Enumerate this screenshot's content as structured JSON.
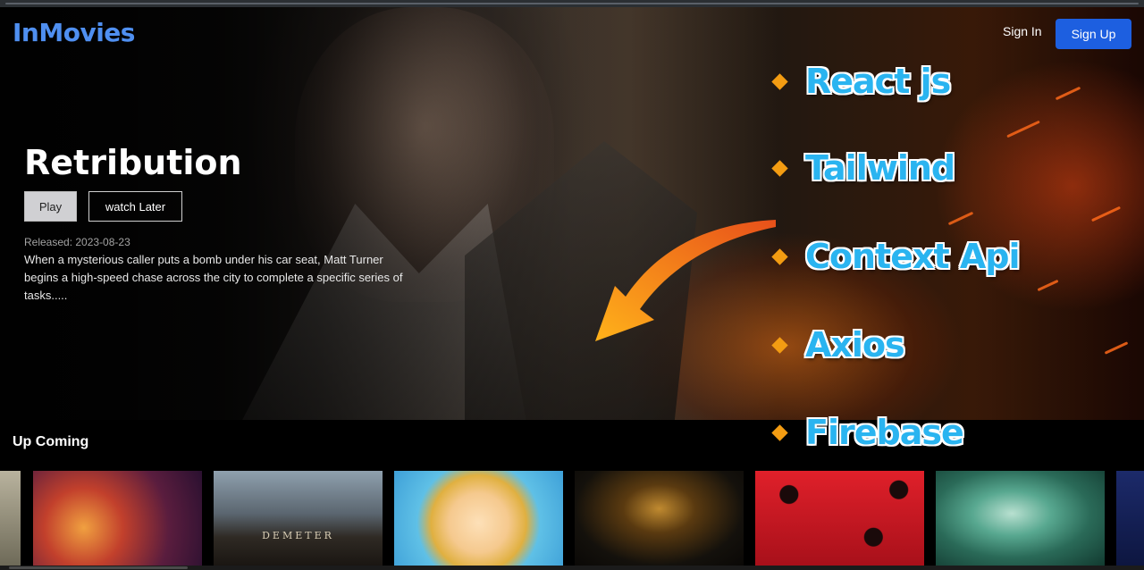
{
  "app": {
    "logo": "InMovies"
  },
  "header": {
    "signin_label": "Sign In",
    "signup_label": "Sign Up"
  },
  "hero": {
    "title": "Retribution",
    "play_label": "Play",
    "watch_later_label": "watch Later",
    "released": "Released: 2023-08-23",
    "overview": "When a mysterious caller puts a bomb under his car seat, Matt Turner begins a high-speed chase across the city to complete a specific series of tasks....."
  },
  "overlay": {
    "tech_stack": [
      "React js",
      "Tailwind",
      "Context Api",
      "Axios",
      "Firebase"
    ],
    "bullet_color": "#f39c12",
    "text_color": "#2ab4f0",
    "arrow_color": "#f7941d"
  },
  "row": {
    "title": "Up Coming",
    "poster_caption": "DEMETER"
  },
  "colors": {
    "brand": "#4f8ff0",
    "signup_bg": "#1d5fe0",
    "page_bg": "#000000"
  }
}
